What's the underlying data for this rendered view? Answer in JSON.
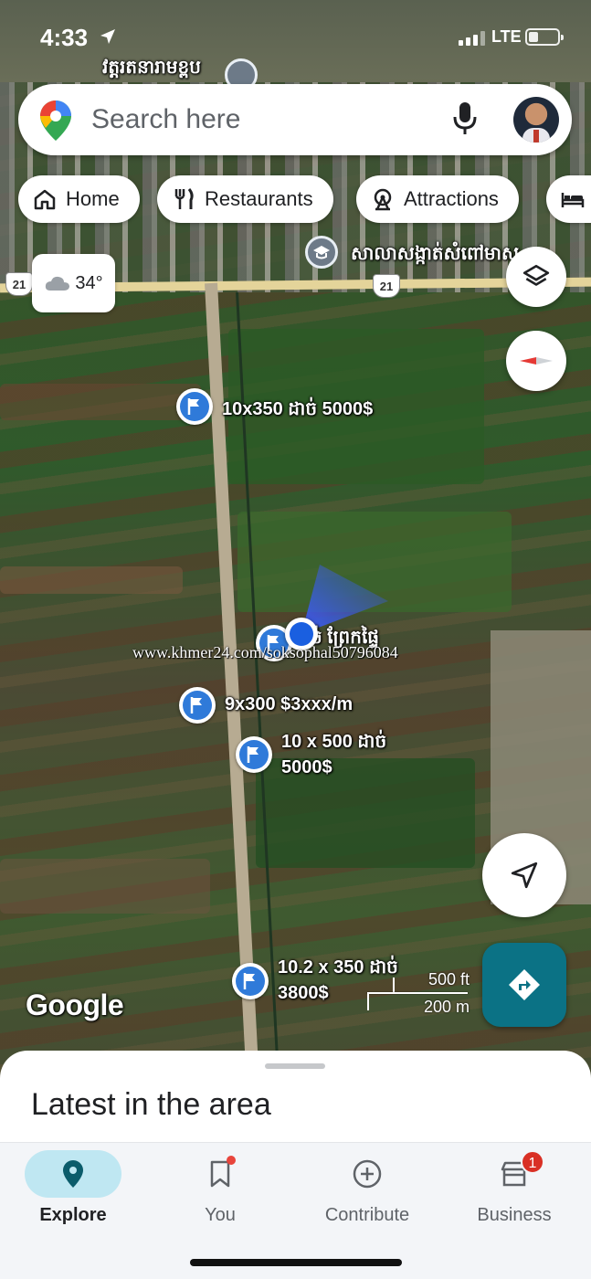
{
  "status_bar": {
    "time": "4:33",
    "network": "LTE"
  },
  "map_labels": {
    "pagoda": "វត្តរតនារាមខ្ពប",
    "school": "សាលាសង្កាត់សំពៅមាស",
    "route_number": "21"
  },
  "search": {
    "placeholder": "Search here"
  },
  "chips": [
    {
      "label": "Home",
      "icon": "home-icon"
    },
    {
      "label": "Restaurants",
      "icon": "fork-knife-icon"
    },
    {
      "label": "Attractions",
      "icon": "ferris-wheel-icon"
    },
    {
      "label": "",
      "icon": "bed-icon"
    }
  ],
  "weather": {
    "temperature": "34°",
    "icon": "cloud-icon"
  },
  "listings": [
    {
      "label": "10x350 ដាច់ 5000$"
    },
    {
      "label": "ច់ ព្រែកផ្ទៃ"
    },
    {
      "label": "9x300 $3xxx/m"
    },
    {
      "label": "10 x 500 ដាច់\n5000$"
    },
    {
      "label": "10.2 x 350 ដាច់\n3800$"
    }
  ],
  "watermark": "www.khmer24.com/soksophal50796084",
  "google_logo": "Google",
  "scale": {
    "feet": "500 ft",
    "meters": "200 m"
  },
  "sheet": {
    "title": "Latest in the area"
  },
  "bottom_nav": [
    {
      "label": "Explore",
      "icon": "location-pin-icon",
      "active": true
    },
    {
      "label": "You",
      "icon": "bookmark-icon"
    },
    {
      "label": "Contribute",
      "icon": "plus-circle-icon"
    },
    {
      "label": "Business",
      "icon": "store-icon",
      "badge": "1"
    }
  ],
  "colors": {
    "pin_blue": "#2f7ad9",
    "directions_teal": "#0b7285",
    "explore_active": "#bfe7f2",
    "my_location": "#1a5fe0"
  }
}
